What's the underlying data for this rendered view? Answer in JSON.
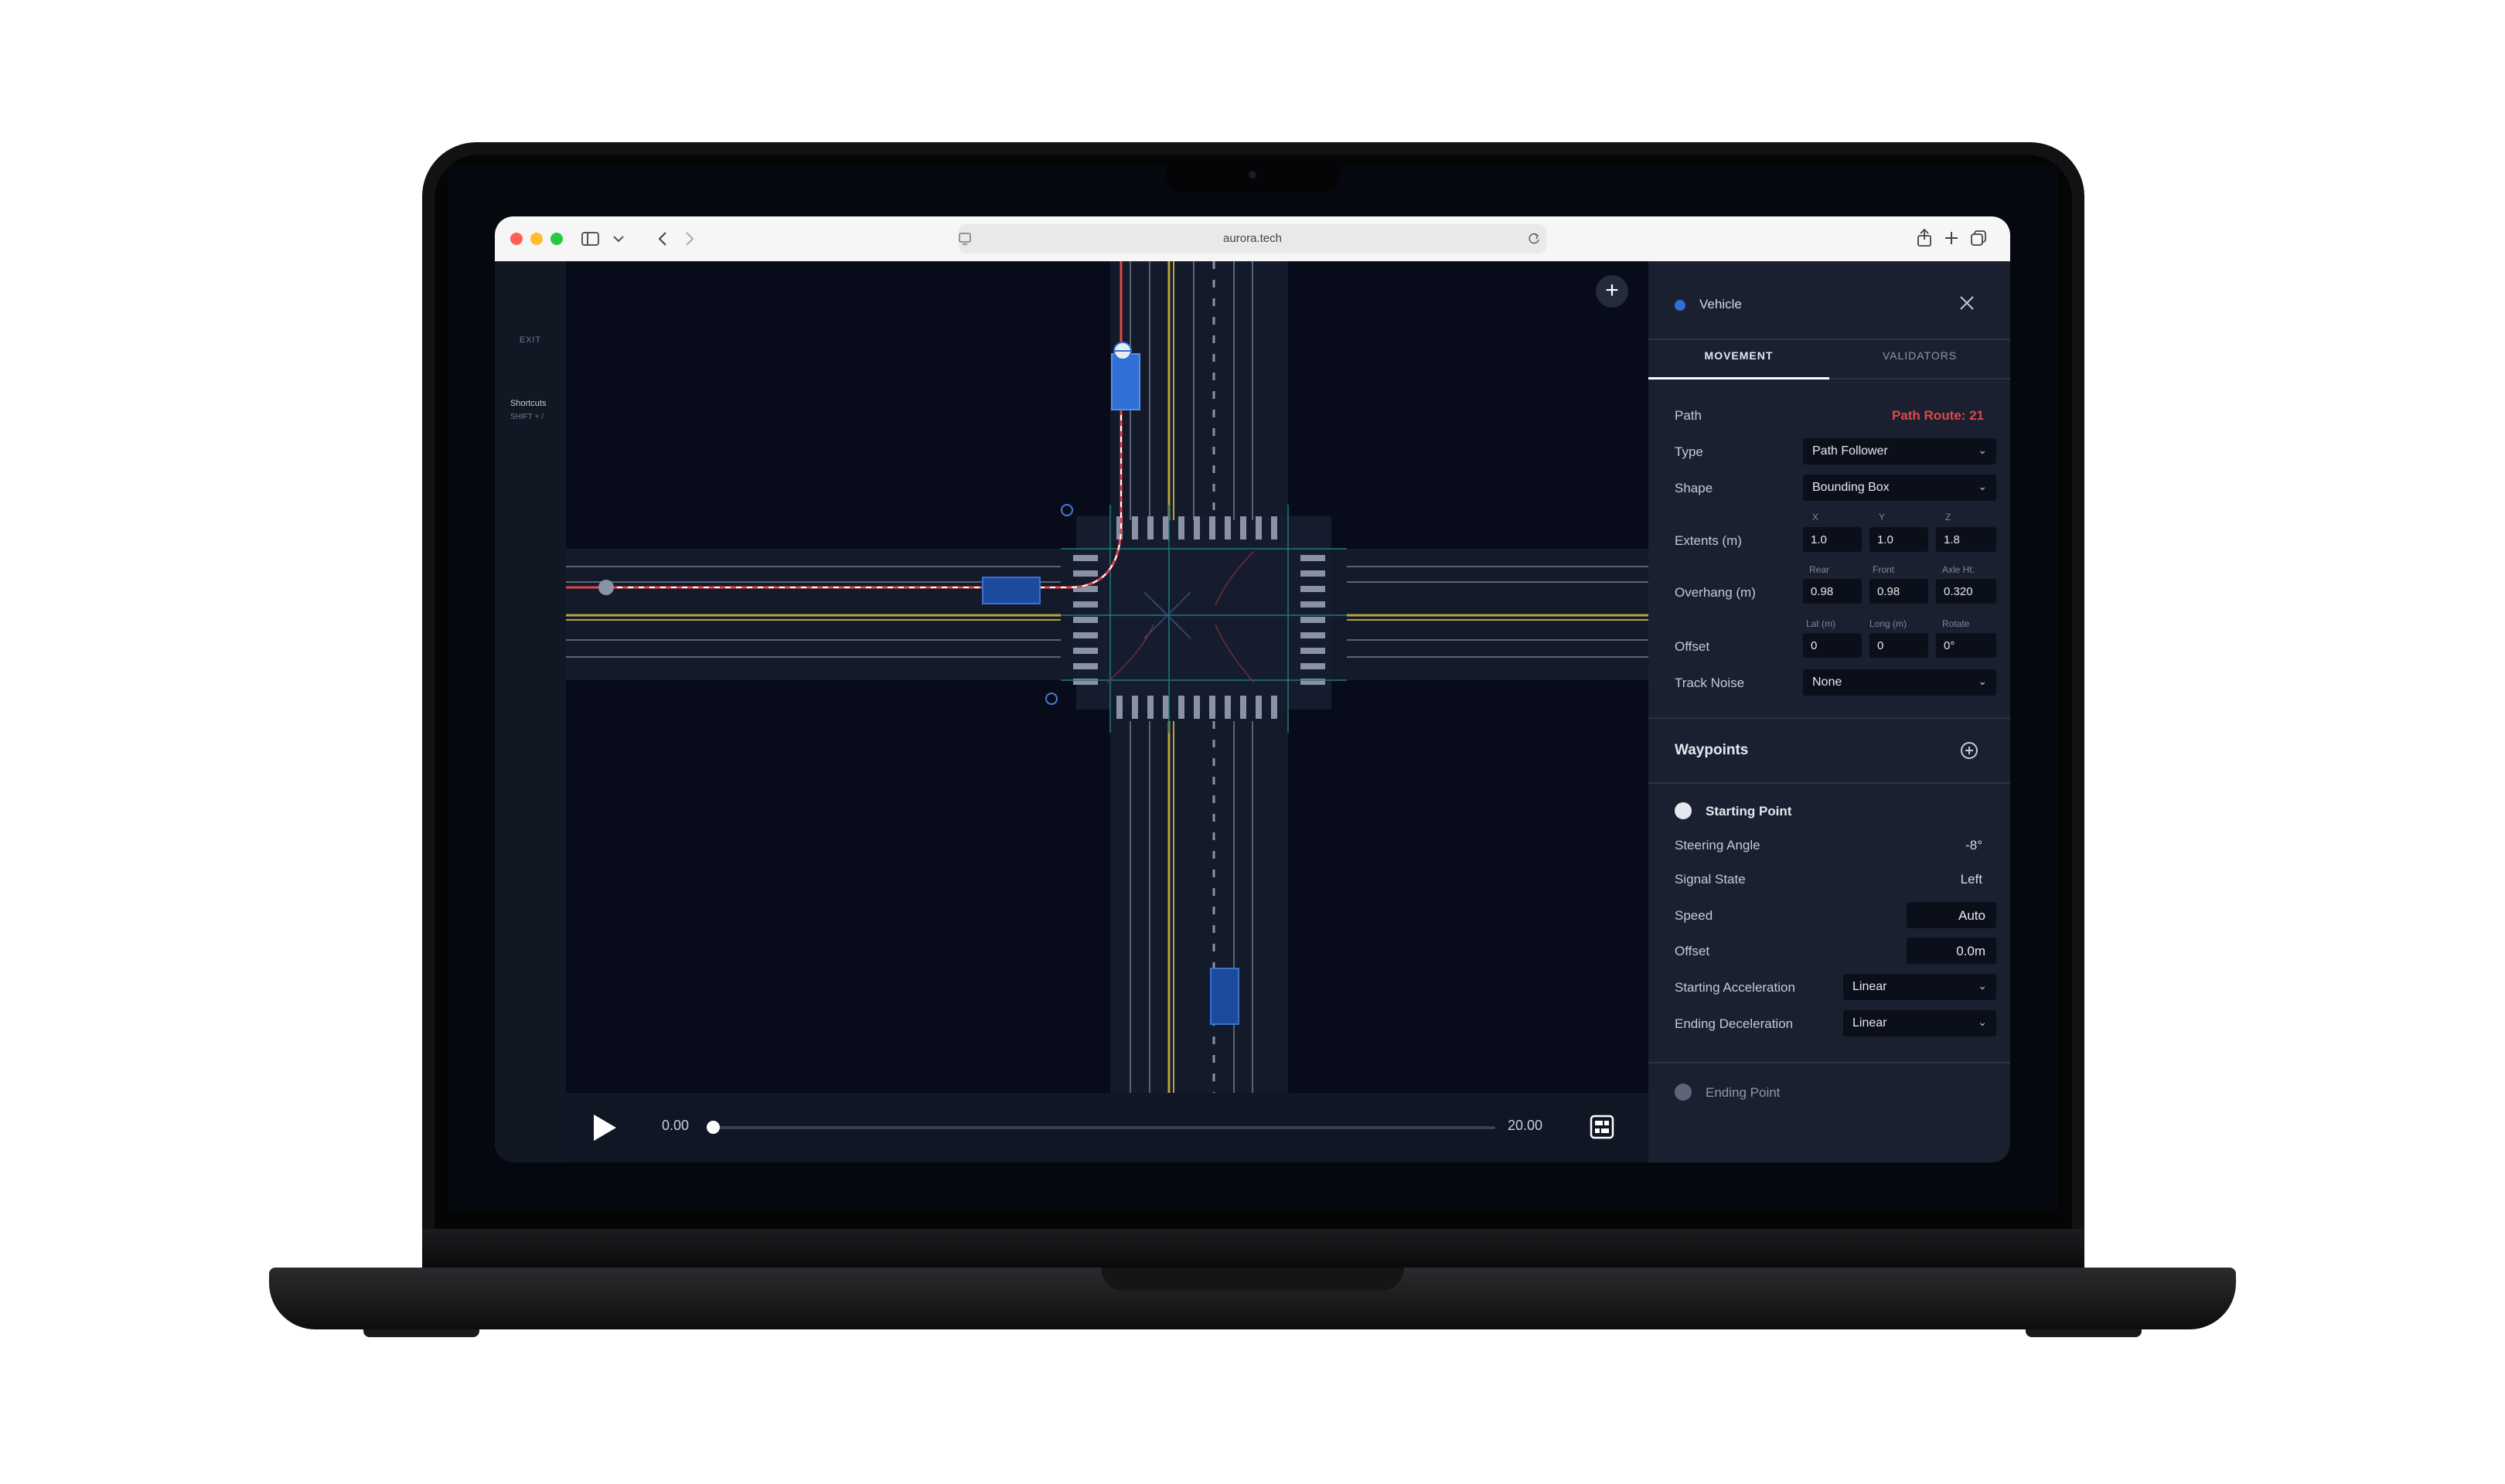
{
  "browser": {
    "url": "aurora.tech"
  },
  "leftbar": {
    "exit_label": "EXIT",
    "shortcuts_label": "Shortcuts",
    "shortcuts_key": "SHIFT + /"
  },
  "playback": {
    "start_time": "0.00",
    "end_time": "20.00",
    "progress": 0
  },
  "panel": {
    "title": "Vehicle",
    "tabs": [
      "MOVEMENT",
      "VALIDATORS"
    ],
    "active_tab": "MOVEMENT",
    "path_label": "Path",
    "path_value": "Path Route: 21",
    "type_label": "Type",
    "type_value": "Path Follower",
    "shape_label": "Shape",
    "shape_value": "Bounding Box",
    "extents": {
      "label": "Extents (m)",
      "headers": [
        "X",
        "Y",
        "Z"
      ],
      "values": [
        "1.0",
        "1.0",
        "1.8"
      ]
    },
    "overhang": {
      "label": "Overhang (m)",
      "headers": [
        "Rear",
        "Front",
        "Axle Ht."
      ],
      "values": [
        "0.98",
        "0.98",
        "0.320"
      ]
    },
    "offset": {
      "label": "Offset",
      "headers": [
        "Lat (m)",
        "Long (m)",
        "Rotate"
      ],
      "values": [
        "0",
        "0",
        "0°"
      ]
    },
    "track_noise_label": "Track Noise",
    "track_noise_value": "None",
    "waypoints_title": "Waypoints",
    "starting_point": {
      "title": "Starting Point",
      "steering_angle_label": "Steering Angle",
      "steering_angle_value": "-8°",
      "signal_state_label": "Signal State",
      "signal_state_value": "Left",
      "speed_label": "Speed",
      "speed_value": "Auto",
      "offset_label": "Offset",
      "offset_value": "0.0m",
      "start_accel_label": "Starting Acceleration",
      "start_accel_value": "Linear",
      "end_decel_label": "Ending Deceleration",
      "end_decel_value": "Linear"
    },
    "ending_point_title": "Ending Point"
  },
  "colors": {
    "accent_blue": "#2f6fd6",
    "route_red": "#e0474c",
    "lane_yellow": "#b8a23a",
    "canvas_bg": "#080c1a",
    "panel_bg": "#1a2030"
  }
}
